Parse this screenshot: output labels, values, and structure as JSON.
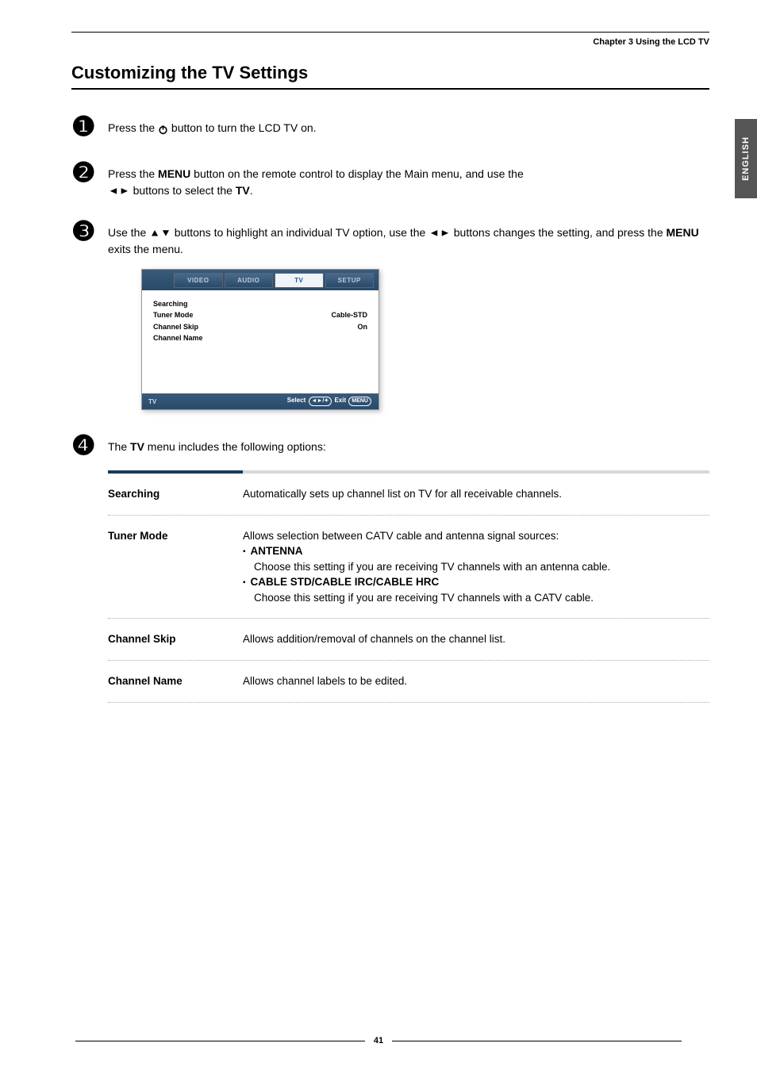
{
  "chapter": "Chapter 3 Using the LCD TV",
  "side_tab": "ENGLISH",
  "title": "Customizing the TV Settings",
  "steps": {
    "s1": {
      "num": "❶",
      "text_before": "Press the ",
      "text_after": " button to turn the LCD TV on."
    },
    "s2": {
      "num": "❷",
      "text1": "Press the ",
      "menu": "MENU",
      "text2": " button on the remote control to display the Main menu, and use the ",
      "text3": " buttons to select the ",
      "tv": "TV",
      "text4": "."
    },
    "s3": {
      "num": "❸",
      "text1": "Use the ",
      "text2": " buttons to highlight an individual TV option, use the ",
      "text3": " buttons changes the setting, and press the ",
      "menu": "MENU",
      "text4": " exits the menu."
    },
    "s4": {
      "num": "❹",
      "text1": "The ",
      "tv": "TV",
      "text2": " menu includes the following options:"
    }
  },
  "arrows": {
    "lr": "◄►",
    "ud": "▲▼"
  },
  "osd": {
    "tabs": [
      "VIDEO",
      "AUDIO",
      "TV",
      "SETUP"
    ],
    "active_index": 2,
    "rows": [
      {
        "label": "Searching",
        "value": ""
      },
      {
        "label": "Tuner Mode",
        "value": "Cable-STD"
      },
      {
        "label": "Channel Skip",
        "value": "On"
      },
      {
        "label": "Channel Name",
        "value": ""
      }
    ],
    "footer_left": "TV",
    "footer_select": "Select",
    "footer_nav": "◄►/",
    "footer_enter_icon": "✦",
    "footer_exit": "Exit",
    "footer_menu": "MENU"
  },
  "options": [
    {
      "name": "Searching",
      "desc_plain": "Automatically sets up channel list on TV for all receivable channels."
    },
    {
      "name": "Tuner Mode",
      "desc_intro": "Allows selection between CATV cable and antenna signal sources:",
      "bullets": [
        {
          "head": "ANTENNA",
          "body": "Choose this setting if you are receiving TV channels with an antenna cable."
        },
        {
          "head": "CABLE STD/CABLE IRC/CABLE HRC",
          "body": "Choose this setting if you are receiving TV channels with a CATV cable."
        }
      ]
    },
    {
      "name": "Channel Skip",
      "desc_plain": "Allows addition/removal of channels on the channel list."
    },
    {
      "name": "Channel Name",
      "desc_plain": "Allows channel labels to be edited."
    }
  ],
  "page_number": "41"
}
